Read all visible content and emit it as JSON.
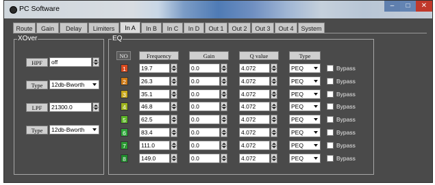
{
  "window": {
    "title": "PC Software",
    "icon": "app-icon"
  },
  "tabs": [
    {
      "label": "Route"
    },
    {
      "label": "Gain"
    },
    {
      "label": "Delay"
    },
    {
      "label": "Limiters"
    },
    {
      "label": "In A",
      "active": true
    },
    {
      "label": "In B"
    },
    {
      "label": "In C"
    },
    {
      "label": "In D"
    },
    {
      "label": "Out 1"
    },
    {
      "label": "Out 2"
    },
    {
      "label": "Out 3"
    },
    {
      "label": "Out 4"
    },
    {
      "label": "System"
    }
  ],
  "xover": {
    "title": "XOver",
    "hpf_label": "HPF",
    "hpf_value": "off",
    "hpf_type_label": "Type",
    "hpf_type_value": "12db-Bworth",
    "lpf_label": "LPF",
    "lpf_value": "21300.0",
    "lpf_type_label": "Type",
    "lpf_type_value": "12db-Bworth"
  },
  "eq": {
    "title": "EQ",
    "headers": {
      "no": "NO",
      "frequency": "Frequency",
      "gain": "Gain",
      "q": "Q value",
      "type": "Type"
    },
    "bypass_label": "Bypass",
    "bands": [
      {
        "no": "1",
        "color": "#d94a1e",
        "frequency": "19.7",
        "gain": "0.0",
        "q": "4.072",
        "type": "PEQ"
      },
      {
        "no": "2",
        "color": "#d07a14",
        "frequency": "26.3",
        "gain": "0.0",
        "q": "4.072",
        "type": "PEQ"
      },
      {
        "no": "3",
        "color": "#c9a81a",
        "frequency": "35.1",
        "gain": "0.0",
        "q": "4.072",
        "type": "PEQ"
      },
      {
        "no": "4",
        "color": "#9fb51e",
        "frequency": "46.8",
        "gain": "0.0",
        "q": "4.072",
        "type": "PEQ"
      },
      {
        "no": "5",
        "color": "#5cb526",
        "frequency": "62.5",
        "gain": "0.0",
        "q": "4.072",
        "type": "PEQ"
      },
      {
        "no": "6",
        "color": "#2ea83a",
        "frequency": "83.4",
        "gain": "0.0",
        "q": "4.072",
        "type": "PEQ"
      },
      {
        "no": "7",
        "color": "#2b9a32",
        "frequency": "111.0",
        "gain": "0.0",
        "q": "4.072",
        "type": "PEQ"
      },
      {
        "no": "8",
        "color": "#1f8a2c",
        "frequency": "149.0",
        "gain": "0.0",
        "q": "4.072",
        "type": "PEQ"
      }
    ]
  }
}
